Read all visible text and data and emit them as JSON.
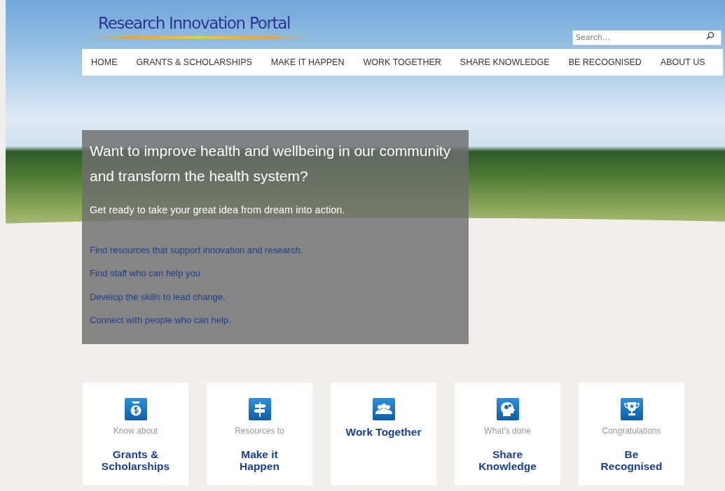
{
  "logo": {
    "title": "Research Innovation Portal"
  },
  "search": {
    "placeholder": "Search..."
  },
  "nav": [
    {
      "label": "HOME"
    },
    {
      "label": "GRANTS & SCHOLARSHIPS"
    },
    {
      "label": "MAKE IT HAPPEN"
    },
    {
      "label": "WORK TOGETHER"
    },
    {
      "label": "SHARE KNOWLEDGE"
    },
    {
      "label": "BE RECOGNISED"
    },
    {
      "label": "ABOUT US"
    }
  ],
  "hero": {
    "heading": "Want to improve health and wellbeing in our community and transform the health system?",
    "subtitle": "Get ready to take your great idea from dream into action.",
    "links": [
      "Find resources that support innovation and research.",
      "Find staff who can help you",
      "Develop the skills to lead change.",
      "Connect with people who can help."
    ]
  },
  "tiles": [
    {
      "kind": "money",
      "caption": "Know about",
      "title": "Grants & Scholarships"
    },
    {
      "kind": "signpost",
      "caption": "Resources to",
      "title": "Make it Happen"
    },
    {
      "kind": "people",
      "title": "Work Together"
    },
    {
      "kind": "head",
      "caption": "What's done",
      "title": "Share Knowledge"
    },
    {
      "kind": "trophy",
      "caption": "Congratulations",
      "title": "Be Recognised"
    }
  ]
}
